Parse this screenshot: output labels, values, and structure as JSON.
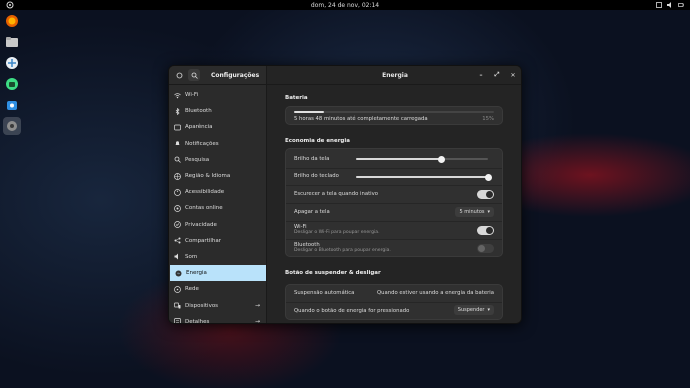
{
  "topbar": {
    "clock": "dom, 24 de nov, 02:14"
  },
  "dock": [
    "firefox-icon",
    "files-icon",
    "software-icon",
    "android-studio-icon",
    "store-icon",
    "settings-icon"
  ],
  "settings": {
    "sidebar_title": "Configurações",
    "window_title": "Energia",
    "sidebar_items": [
      {
        "label": "Wi-Fi",
        "icon": "wifi-icon"
      },
      {
        "label": "Bluetooth",
        "icon": "bluetooth-icon"
      },
      {
        "label": "Aparência",
        "icon": "appearance-icon"
      },
      {
        "label": "Notificações",
        "icon": "bell-icon"
      },
      {
        "label": "Pesquisa",
        "icon": "search-icon"
      },
      {
        "label": "Região & Idioma",
        "icon": "globe-icon"
      },
      {
        "label": "Acessibilidade",
        "icon": "accessibility-icon"
      },
      {
        "label": "Contas online",
        "icon": "accounts-icon"
      },
      {
        "label": "Privacidade",
        "icon": "privacy-icon"
      },
      {
        "label": "Compartilhar",
        "icon": "share-icon"
      },
      {
        "label": "Som",
        "icon": "sound-icon"
      },
      {
        "label": "Energia",
        "icon": "power-icon"
      },
      {
        "label": "Rede",
        "icon": "network-icon"
      },
      {
        "label": "Dispositivos",
        "icon": "devices-icon"
      },
      {
        "label": "Detalhes",
        "icon": "details-icon"
      }
    ],
    "battery": {
      "heading": "Bateria",
      "status": "5 horas 48 minutos até completamente carregada",
      "percent": "15%",
      "level": 0.15
    },
    "saving": {
      "heading": "Economia de energia",
      "screen_brightness": "Brilho da tela",
      "screen_brightness_level": 0.65,
      "keyboard_brightness": "Brilho do teclado",
      "keyboard_brightness_level": 1.0,
      "dim_screen": "Escurecer a tela quando inativo",
      "dim_screen_on": true,
      "blank_screen": "Apagar a tela",
      "blank_screen_value": "5 minutos",
      "wifi_label": "Wi-Fi",
      "wifi_sub": "Desligar o Wi-Fi para poupar energia.",
      "wifi_on": true,
      "bt_label": "Bluetooth",
      "bt_sub": "Desligar o Bluetooth para poupar energia.",
      "bt_on": false
    },
    "suspend": {
      "heading": "Botão de suspender & desligar",
      "auto_suspend": "Suspensão automática",
      "auto_suspend_value": "Quando estiver usando a energia da bateria",
      "power_button": "Quando o botão de energia for pressionado",
      "power_button_value": "Suspender"
    }
  }
}
